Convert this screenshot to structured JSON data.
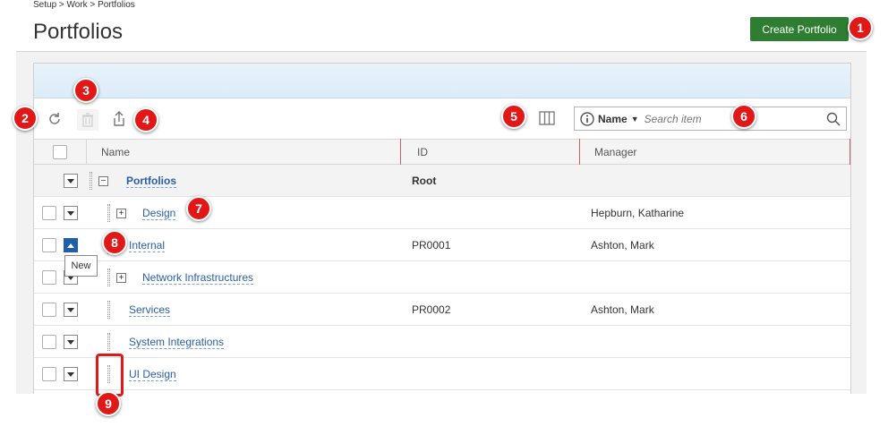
{
  "breadcrumb": "Setup > Work > Portfolios",
  "page": {
    "title": "Portfolios"
  },
  "actions": {
    "create_label": "Create Portfolio"
  },
  "toolbar": {
    "search_field_label": "Name",
    "search_placeholder": "Search item"
  },
  "columns": {
    "name": "Name",
    "id": "ID",
    "manager": "Manager"
  },
  "rows": [
    {
      "name": "Portfolios",
      "id": "Root",
      "manager": ""
    },
    {
      "name": "Design",
      "id": "",
      "manager": "Hepburn, Katharine"
    },
    {
      "name": "Internal",
      "id": "PR0001",
      "manager": "Ashton, Mark"
    },
    {
      "name": "Network Infrastructures",
      "id": "",
      "manager": ""
    },
    {
      "name": "Services",
      "id": "PR0002",
      "manager": "Ashton, Mark"
    },
    {
      "name": "System Integrations",
      "id": "",
      "manager": ""
    },
    {
      "name": "UI Design",
      "id": "",
      "manager": ""
    }
  ],
  "tooltip": "New",
  "markers": [
    "1",
    "2",
    "3",
    "4",
    "5",
    "6",
    "7",
    "8",
    "9"
  ],
  "colors": {
    "accent_green": "#2e7d32",
    "marker_red": "#e01818",
    "link_blue": "#2a5ea8",
    "active_blue": "#1f5fa8"
  }
}
